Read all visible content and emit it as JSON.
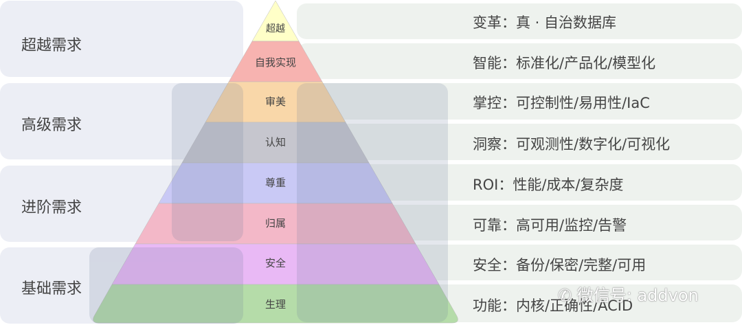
{
  "categories": [
    {
      "label": "超越需求"
    },
    {
      "label": "高级需求"
    },
    {
      "label": "进阶需求"
    },
    {
      "label": "基础需求"
    }
  ],
  "levels": [
    {
      "name": "超越",
      "color": "#ffffc8",
      "description": "变革：真 · 自治数据库"
    },
    {
      "name": "自我实现",
      "color": "#f7b3b0",
      "description": "智能：标准化/产品化/模型化"
    },
    {
      "name": "审美",
      "color": "#f9d7a9",
      "description": "掌控：可控制性/易用性/IaC"
    },
    {
      "name": "认知",
      "color": "#c6c6ce",
      "description": "洞察：可观测性/数字化/可视化"
    },
    {
      "name": "尊重",
      "color": "#c9c9f5",
      "description": "ROI：性能/成本/复杂度"
    },
    {
      "name": "归属",
      "color": "#f3b8c8",
      "description": "可靠：高可用/监控/告警"
    },
    {
      "name": "安全",
      "color": "#e9b9f5",
      "description": "安全：备份/保密/完整/可用"
    },
    {
      "name": "生理",
      "color": "#b5dca9",
      "description": "功能：内核/正确性/ACID"
    }
  ],
  "watermark": "微信号: addvon"
}
